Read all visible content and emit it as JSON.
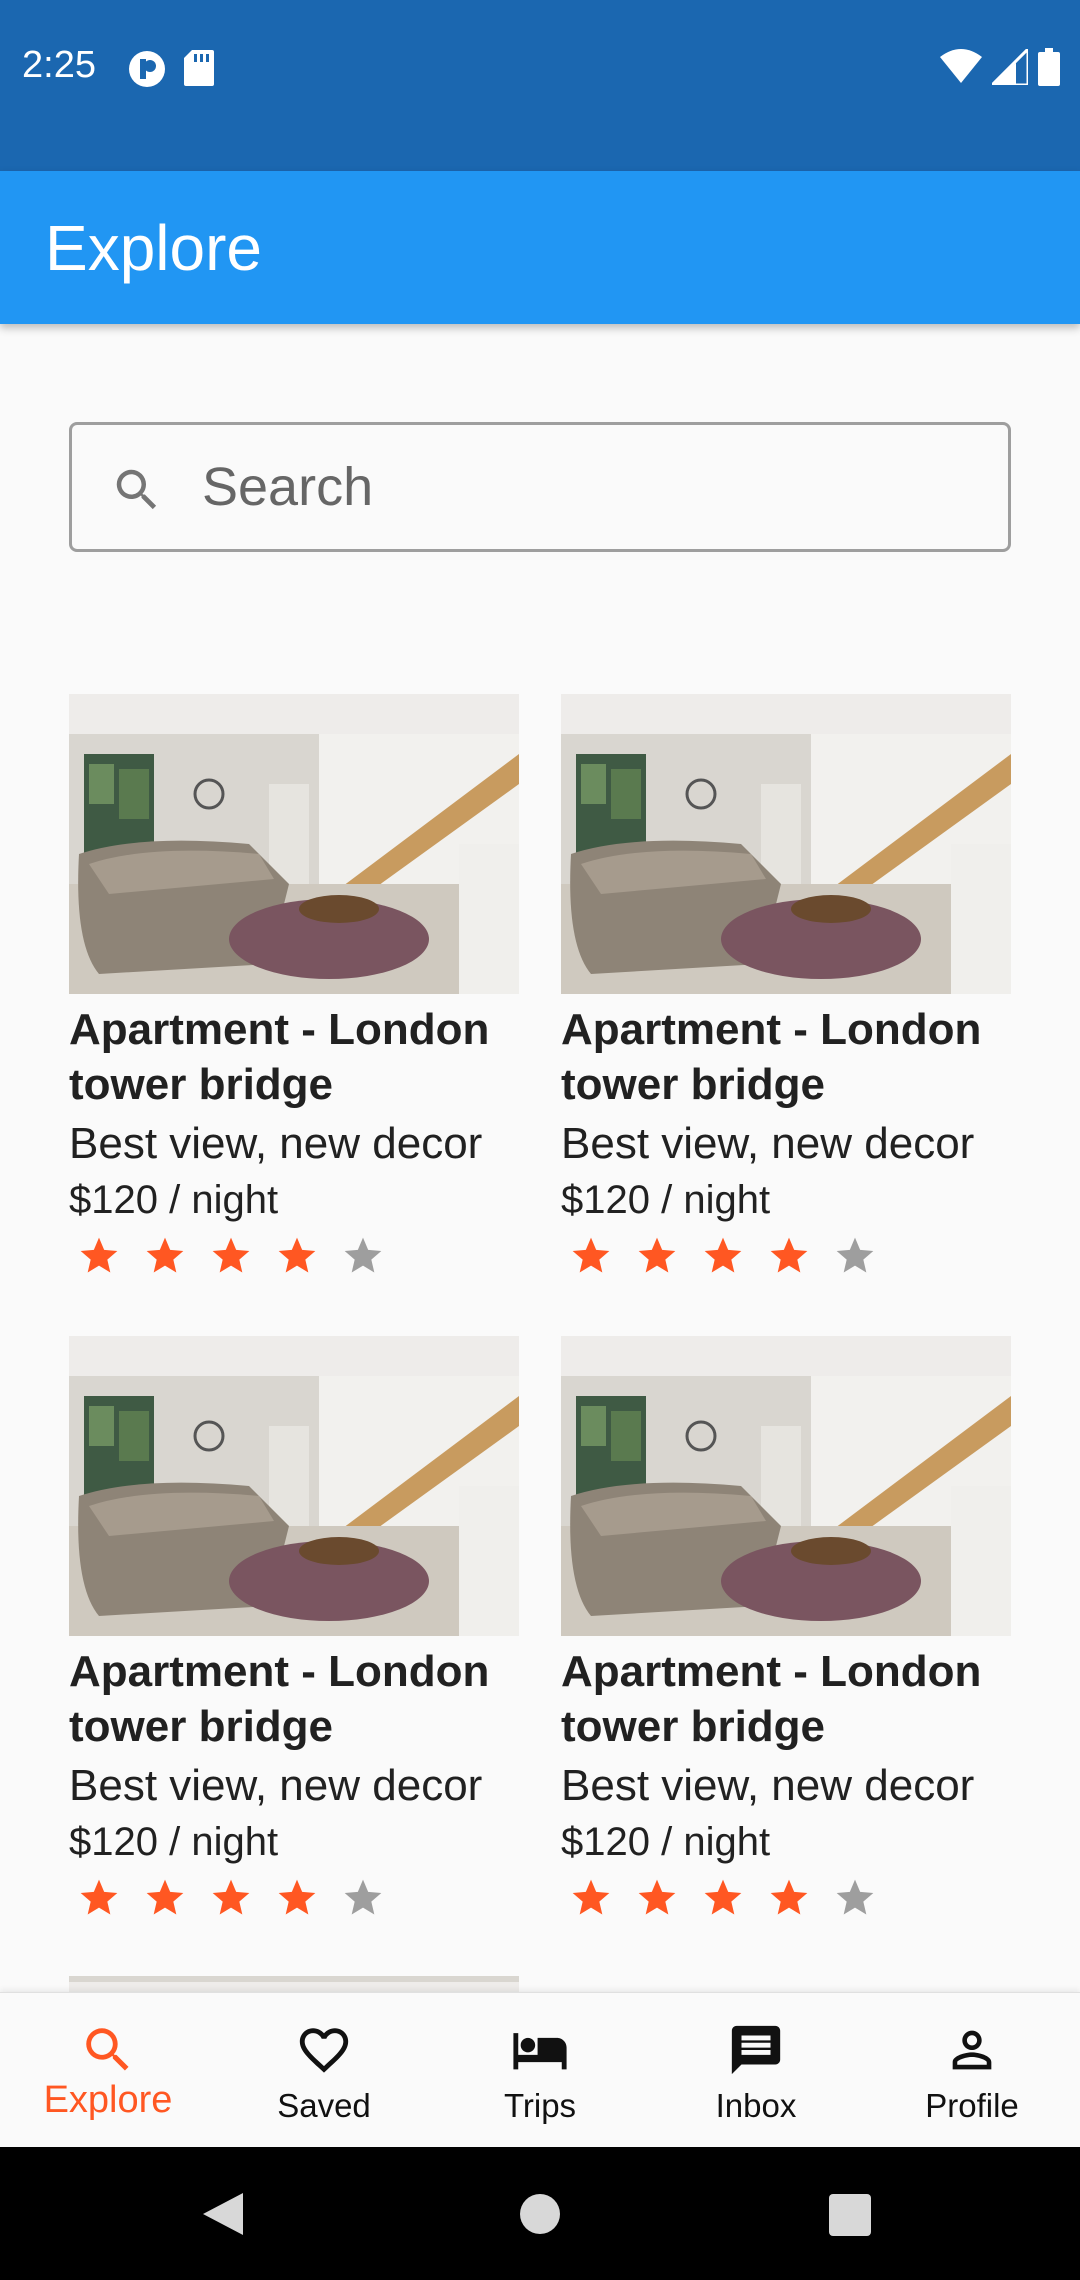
{
  "status": {
    "time": "2:25",
    "left_icons": [
      "app-notification-icon",
      "sd-card-icon"
    ],
    "right_icons": [
      "wifi-icon",
      "cell-signal-icon",
      "battery-icon"
    ]
  },
  "appbar": {
    "title": "Explore"
  },
  "search": {
    "placeholder": "Search",
    "value": ""
  },
  "listings": [
    {
      "title": "Apartment  - London tower bridge",
      "desc": "Best view, new decor",
      "price": "$120 / night",
      "rating": 4,
      "max_rating": 5
    },
    {
      "title": "Apartment  - London tower bridge",
      "desc": "Best view, new decor",
      "price": "$120 / night",
      "rating": 4,
      "max_rating": 5
    },
    {
      "title": "Apartment  - London tower bridge",
      "desc": "Best view, new decor",
      "price": "$120 / night",
      "rating": 4,
      "max_rating": 5
    },
    {
      "title": "Apartment  - London tower bridge",
      "desc": "Best view, new decor",
      "price": "$120 / night",
      "rating": 4,
      "max_rating": 5
    }
  ],
  "bottom_nav": {
    "items": [
      {
        "label": "Explore",
        "icon": "search-icon",
        "active": true
      },
      {
        "label": "Saved",
        "icon": "heart-icon",
        "active": false
      },
      {
        "label": "Trips",
        "icon": "bed-icon",
        "active": false
      },
      {
        "label": "Inbox",
        "icon": "message-icon",
        "active": false
      },
      {
        "label": "Profile",
        "icon": "person-icon",
        "active": false
      }
    ]
  },
  "colors": {
    "status_bar": "#1b67b0",
    "app_bar": "#2196f3",
    "star_filled": "#ff5722",
    "star_empty": "#9e9e9e",
    "nav_active": "#ff5722"
  }
}
